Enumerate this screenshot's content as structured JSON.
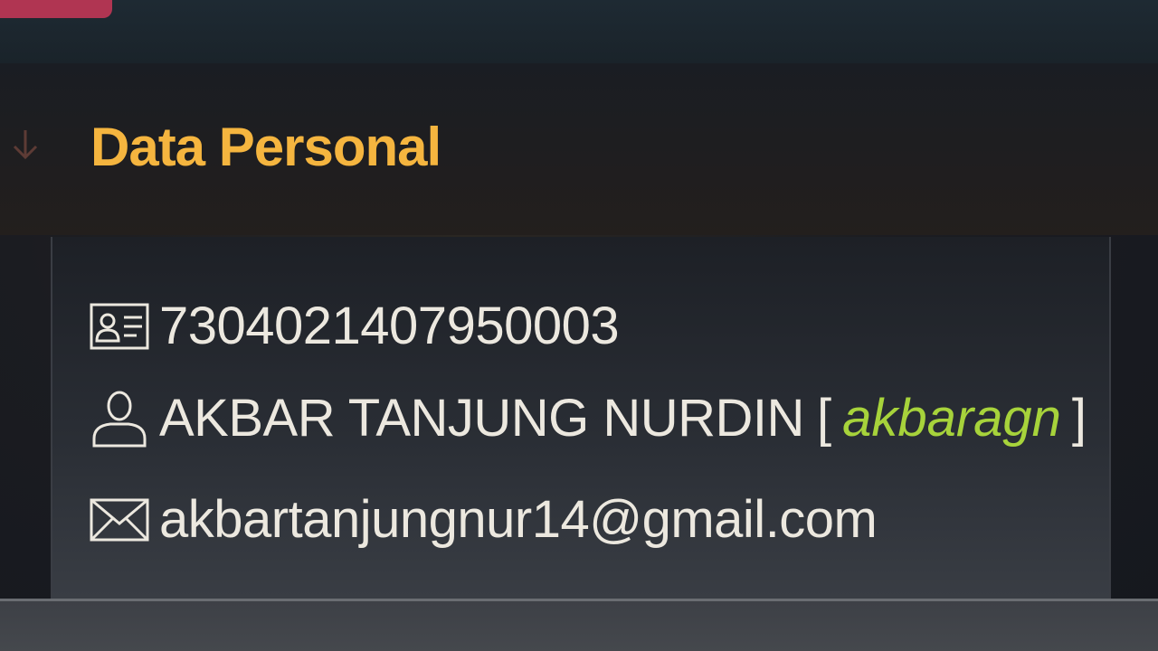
{
  "section": {
    "title": "Data Personal"
  },
  "profile": {
    "id_number": "7304021407950003",
    "full_name": "AKBAR TANJUNG NURDIN",
    "bracket_open": "[",
    "username": "akbaragn",
    "bracket_close": "]",
    "email": "akbartanjungnur14@gmail.com"
  },
  "icons": {
    "id": "id-card-icon",
    "name": "user-icon",
    "email": "envelope-icon",
    "collapse": "arrow-down-icon"
  },
  "colors": {
    "title": "#f5b53f",
    "username": "#a7d33b",
    "text": "#ece8df",
    "accent_tab": "#b03552"
  }
}
